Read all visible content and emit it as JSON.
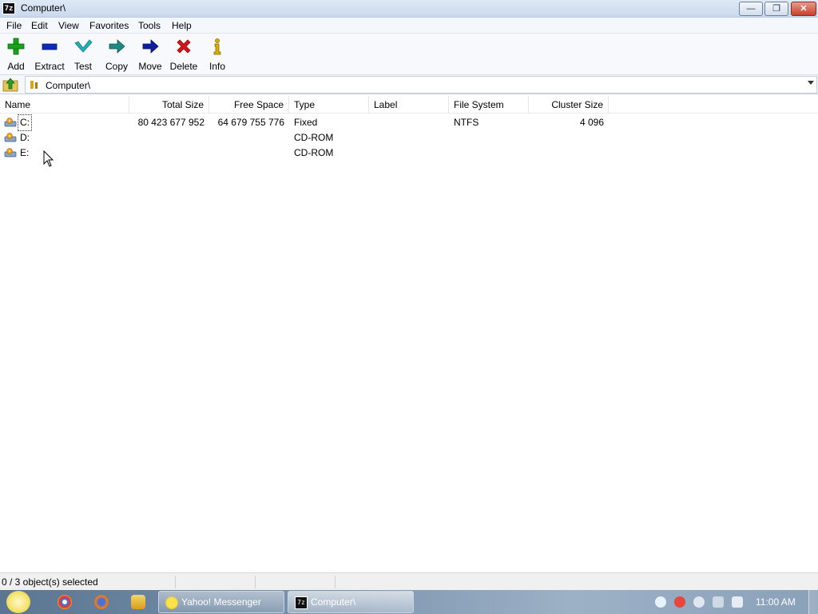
{
  "window": {
    "title": "Computer\\",
    "app_icon_text": "7z",
    "minimize": "—",
    "maximize": "❐",
    "close": "✕"
  },
  "menu": [
    "File",
    "Edit",
    "View",
    "Favorites",
    "Tools",
    "Help"
  ],
  "toolbar": [
    {
      "label": "Add",
      "icon": "plus-icon",
      "color": "#1aa11a"
    },
    {
      "label": "Extract",
      "icon": "minus-icon",
      "color": "#0b2bb8"
    },
    {
      "label": "Test",
      "icon": "checkmark-icon",
      "color": "#1fb1b8"
    },
    {
      "label": "Copy",
      "icon": "arrow-right-icon",
      "color": "#1c8a83"
    },
    {
      "label": "Move",
      "icon": "arrow-right-icon",
      "color": "#0d1f9e"
    },
    {
      "label": "Delete",
      "icon": "x-icon",
      "color": "#d4151a"
    },
    {
      "label": "Info",
      "icon": "info-icon",
      "color": "#d6b000"
    }
  ],
  "address": {
    "value": "Computer\\"
  },
  "columns": [
    "Name",
    "Total Size",
    "Free Space",
    "Type",
    "Label",
    "File System",
    "Cluster Size"
  ],
  "rows": [
    {
      "name": "C:",
      "total_size": "80 423 677 952",
      "free_space": "64 679 755 776",
      "type": "Fixed",
      "label": "",
      "file_system": "NTFS",
      "cluster_size": "4 096"
    },
    {
      "name": "D:",
      "total_size": "",
      "free_space": "",
      "type": "CD-ROM",
      "label": "",
      "file_system": "",
      "cluster_size": ""
    },
    {
      "name": "E:",
      "total_size": "",
      "free_space": "",
      "type": "CD-ROM",
      "label": "",
      "file_system": "",
      "cluster_size": ""
    }
  ],
  "status": {
    "selection": "0 / 3 object(s) selected"
  },
  "taskbar": {
    "tasks": [
      {
        "label": "Yahoo! Messenger"
      },
      {
        "label": "Computer\\"
      }
    ],
    "clock": "11:00 AM"
  }
}
